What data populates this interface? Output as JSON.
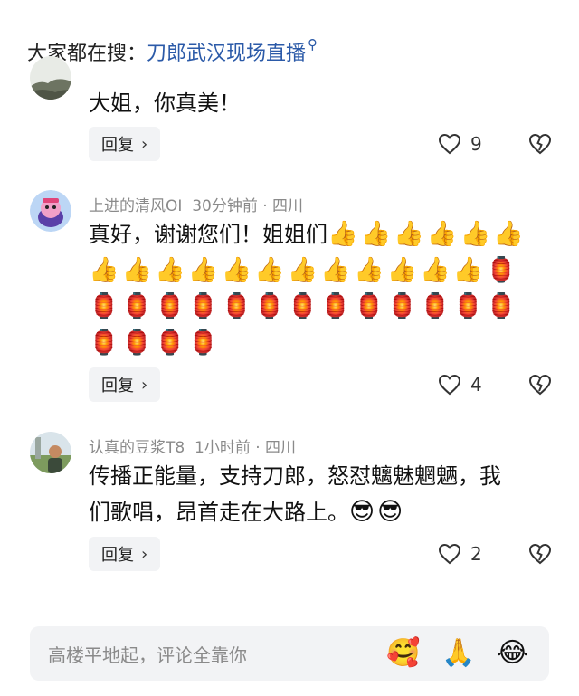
{
  "search": {
    "prefix": "大家都在搜：",
    "query": "刀郎武汉现场直播",
    "icon": "search-icon"
  },
  "comments": [
    {
      "text": "大姐，你真美！",
      "reply_label": "回复",
      "likes": "9"
    },
    {
      "user": "上进的清风OI",
      "time": "30分钟前 · 四川",
      "text": "真好，谢谢您们！姐姐们",
      "emoji_line1": "👍👍👍👍👍👍",
      "emoji_line2": "👍👍👍👍👍👍👍👍👍👍👍👍🏮",
      "emoji_line3": "🏮🏮🏮🏮🏮🏮🏮🏮🏮🏮🏮🏮🏮",
      "emoji_line4": "🏮🏮🏮🏮",
      "reply_label": "回复",
      "likes": "4"
    },
    {
      "user": "认真的豆浆T8",
      "time": "1小时前 · 四川",
      "text_line1": "传播正能量，支持刀郎，怒怼魑魅魍魉，我",
      "text_line2": "们歌唱，昂首走在大路上。",
      "emoji": "😎😎",
      "reply_label": "回复",
      "likes": "2"
    }
  ],
  "input": {
    "placeholder": "高楼平地起，评论全靠你",
    "emojis": [
      "🥰",
      "🙏",
      "😂"
    ]
  },
  "colors": {
    "link": "#2b5aa8",
    "meta": "#8a8a8a",
    "button_bg": "#f2f3f5"
  }
}
